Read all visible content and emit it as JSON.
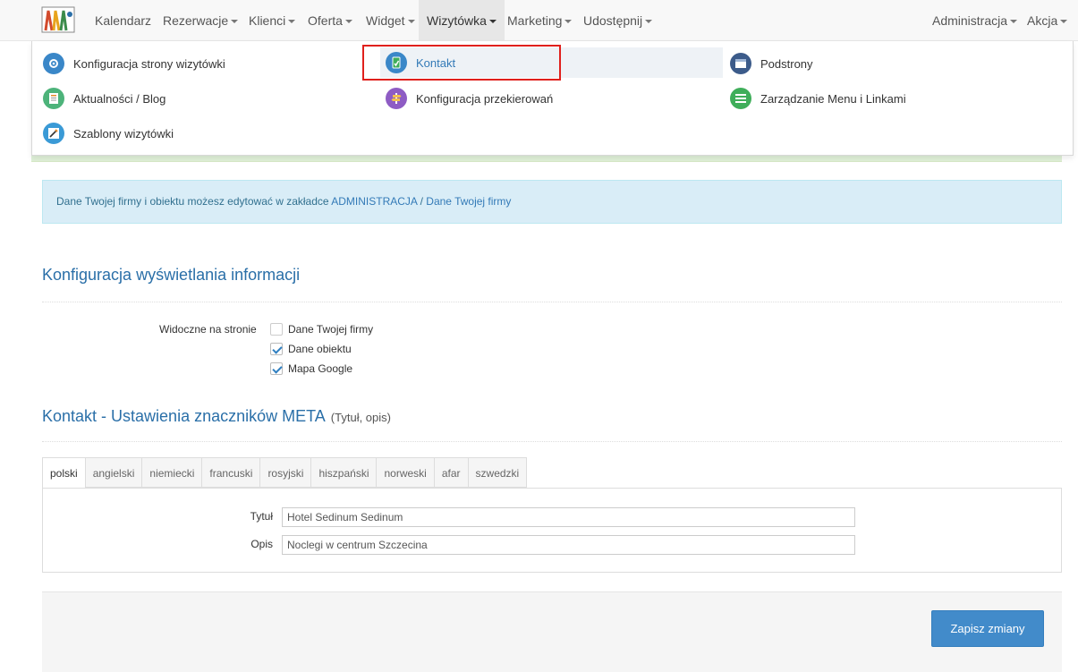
{
  "nav": {
    "left": [
      {
        "label": "Kalendarz",
        "caret": false
      },
      {
        "label": "Rezerwacje",
        "caret": true
      },
      {
        "label": "Klienci",
        "caret": true
      },
      {
        "label": "Oferta",
        "caret": true
      },
      {
        "label": "Widget",
        "caret": true
      },
      {
        "label": "Wizytówka",
        "caret": true,
        "active": true
      },
      {
        "label": "Marketing",
        "caret": true
      },
      {
        "label": "Udostępnij",
        "caret": true
      }
    ],
    "right": [
      {
        "label": "Administracja",
        "caret": true
      },
      {
        "label": "Akcja",
        "caret": true
      }
    ]
  },
  "menu": {
    "items": [
      {
        "label": "Konfiguracja strony wizytówki",
        "icon": "gear-icon",
        "color": "#3a87c8"
      },
      {
        "label": "Kontakt",
        "icon": "phone-card-icon",
        "color": "#3a87c8",
        "highlighted": true
      },
      {
        "label": "Podstrony",
        "icon": "window-icon",
        "color": "#3c5b8a"
      },
      {
        "label": "Aktualności / Blog",
        "icon": "news-icon",
        "color": "#4db37a"
      },
      {
        "label": "Konfiguracja przekierowań",
        "icon": "signpost-icon",
        "color": "#8e5cc4"
      },
      {
        "label": "Zarządzanie Menu i Linkami",
        "icon": "list-icon",
        "color": "#3fae5a"
      },
      {
        "label": "Szablony wizytówki",
        "icon": "pencil-icon",
        "color": "#3a9ad6"
      }
    ]
  },
  "alert": {
    "text": "Dane Twojej firmy i obiektu możesz edytować w zakładce ",
    "link1": "ADMINISTRACJA",
    "sep": " / ",
    "link2": "Dane Twojej firmy"
  },
  "display_config": {
    "title": "Konfiguracja wyświetlania informacji",
    "visible_label": "Widoczne na stronie",
    "options": [
      {
        "label": "Dane Twojej firmy",
        "checked": false
      },
      {
        "label": "Dane obiektu",
        "checked": true
      },
      {
        "label": "Mapa Google",
        "checked": true
      }
    ]
  },
  "meta": {
    "title": "Kontakt - Ustawienia znaczników META",
    "subtitle": "(Tytuł, opis)",
    "tabs": [
      "polski",
      "angielski",
      "niemiecki",
      "francuski",
      "rosyjski",
      "hiszpański",
      "norweski",
      "afar",
      "szwedzki"
    ],
    "active_tab": "polski",
    "title_label": "Tytuł",
    "title_value": "Hotel Sedinum Sedinum",
    "desc_label": "Opis",
    "desc_value": "Noclegi w centrum Szczecina"
  },
  "save_label": "Zapisz zmiany",
  "colors": {
    "accent": "#428bca",
    "heading": "#2a6fa8",
    "highlight_box": "#e0201c"
  }
}
